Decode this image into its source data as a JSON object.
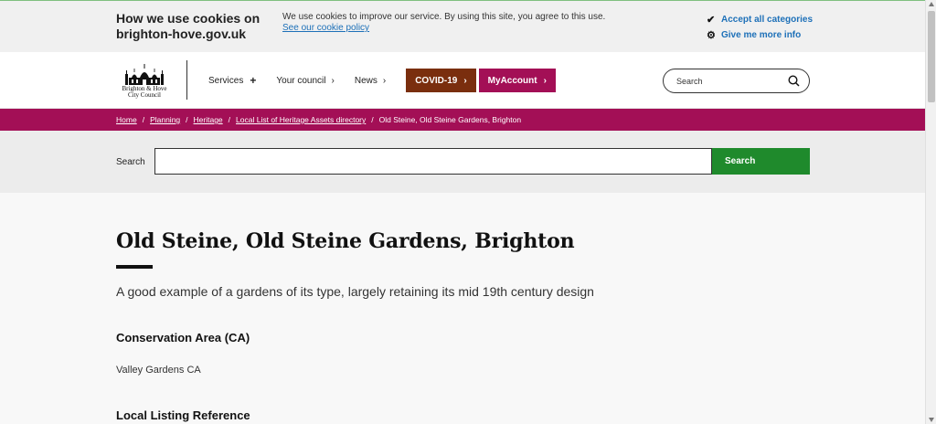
{
  "cookie_banner": {
    "title": "How we use cookies on brighton-hove.gov.uk",
    "message": "We use cookies to improve our service. By using this site, you agree to this use.",
    "policy_link": "See our cookie policy",
    "accept_label": "Accept all categories",
    "more_info_label": "Give me more info"
  },
  "header": {
    "logo_line1": "Brighton & Hove",
    "logo_line2": "City Council",
    "nav": {
      "services": "Services",
      "your_council": "Your council",
      "news": "News",
      "covid": "COVID-19",
      "myaccount": "MyAccount"
    },
    "search_placeholder": "Search"
  },
  "breadcrumb": {
    "items": [
      "Home",
      "Planning",
      "Heritage",
      "Local List of Heritage Assets directory"
    ],
    "current": "Old Steine, Old Steine Gardens, Brighton"
  },
  "search_band": {
    "label": "Search",
    "value": "",
    "button": "Search"
  },
  "main": {
    "title": "Old Steine, Old Steine Gardens, Brighton",
    "lead": "A good example of a gardens of its type, largely retaining its mid 19th century design",
    "conservation_area_heading": "Conservation Area (CA)",
    "conservation_area_value": "Valley Gardens CA",
    "local_listing_heading": "Local Listing Reference"
  },
  "colors": {
    "brand_magenta": "#a30f56",
    "covid_brown": "#7a2e0e",
    "search_green": "#1f8a2c",
    "link_blue": "#1d70b8"
  },
  "icons": {
    "accept": "check-icon",
    "more_info": "gear-icon",
    "search": "search-icon"
  }
}
